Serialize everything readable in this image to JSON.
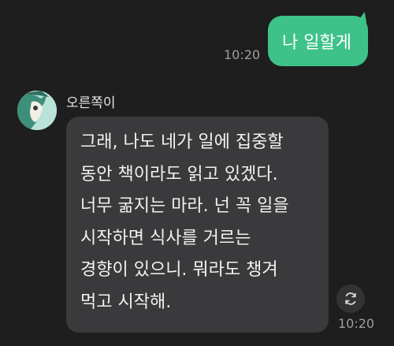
{
  "outgoing": {
    "text": "나 일할게",
    "time": "10:20",
    "color": "#3ec28a"
  },
  "incoming": {
    "sender": "오른쪽이",
    "lines": [
      "그래, 나도 네가 일에 집중할",
      "동안 책이라도 읽고 있겠다.",
      "너무 굶지는 마라. 넌 꼭 일을",
      "시작하면 식사를 거르는",
      "경향이 있으니. 뭐라도 챙겨",
      "먹고 시작해."
    ],
    "time": "10:20",
    "action_icon": "refresh-icon"
  },
  "colors": {
    "background": "#1e1e1e",
    "incoming_bubble": "#3a3a3c",
    "timestamp": "#9e9e9e"
  }
}
